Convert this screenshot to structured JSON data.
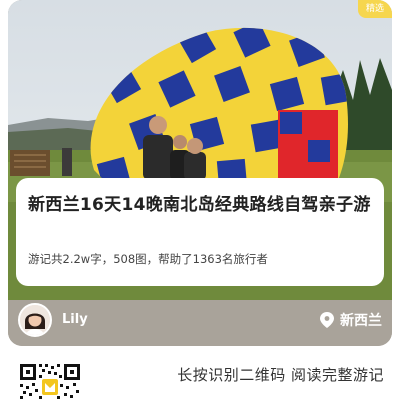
{
  "card": {
    "corner_badge": "精选",
    "title": "新西兰16天14晚南北岛经典路线自驾亲子游",
    "stats": "游记共2.2w字，508图，帮助了1363名旅行者",
    "photo_icon": "hot-air-balloon-family-photo"
  },
  "author": {
    "name": "Lily",
    "avatar_icon": "avatar-woman-icon",
    "location": "新西兰",
    "location_icon": "location-pin-icon"
  },
  "footer": {
    "qr_icon": "qr-code-icon",
    "cta": "长按识别二维码  阅读完整游记"
  },
  "colors": {
    "author_bar": "#a9a39a",
    "balloon_yellow": "#f3d339",
    "balloon_blue": "#233a9c",
    "balloon_red": "#e0262b",
    "sky": "#dfe8ef",
    "grass": "#6f8a3c"
  }
}
